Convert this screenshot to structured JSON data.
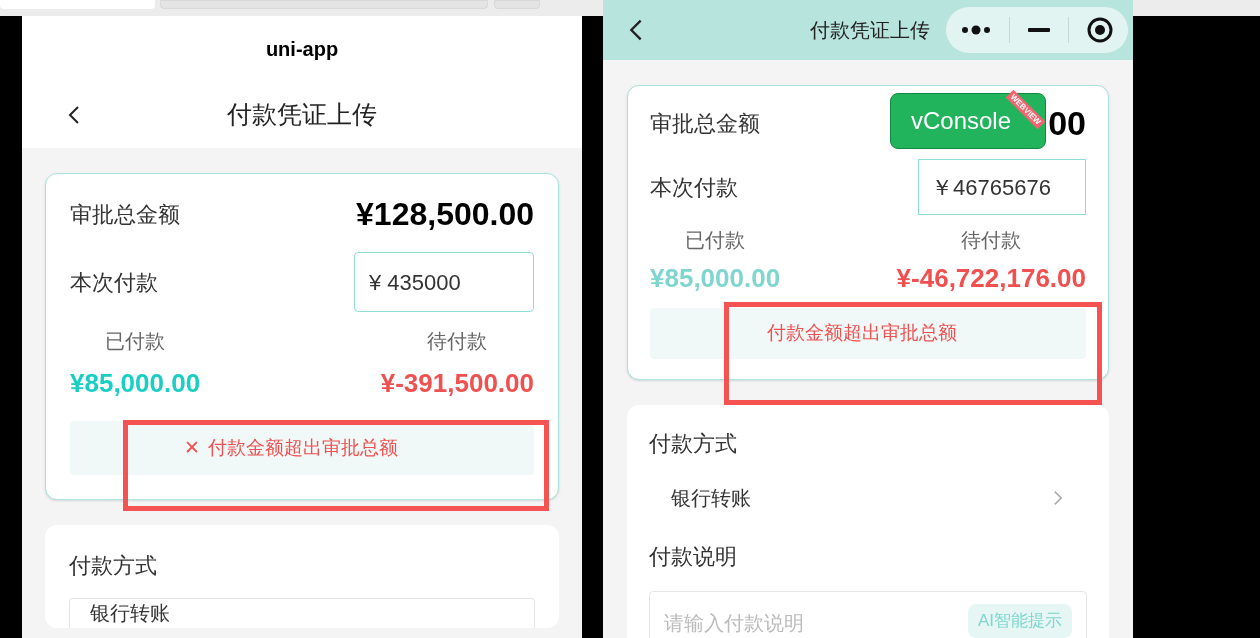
{
  "browser_tabs": [
    {
      "selected": true
    },
    {
      "selected": false
    },
    {
      "selected": false
    }
  ],
  "panels": [
    {
      "kind": "h5",
      "app_name": "uni-app",
      "title": "付款凭证上传",
      "summary": {
        "total_label": "审批总金额",
        "total_value": "¥128,500.00",
        "payment_label": "本次付款",
        "payment_value": "¥ 435000",
        "paid_label": "已付款",
        "paid_value": "¥85,000.00",
        "due_label": "待付款",
        "due_value": "¥-391,500.00",
        "error": {
          "show_icon": true,
          "icon": "✕",
          "text": "付款金额超出审批总额"
        }
      },
      "method": {
        "label": "付款方式",
        "value": "银行转账"
      }
    },
    {
      "kind": "mp",
      "title": "付款凭证上传",
      "summary": {
        "total_label": "审批总金额",
        "total_value": "00",
        "payment_label": "本次付款",
        "payment_value": "￥46765676",
        "paid_label": "已付款",
        "paid_value": "¥85,000.00",
        "due_label": "待付款",
        "due_value": "¥-46,722,176.00",
        "error": {
          "show_icon": false,
          "text": "付款金额超出审批总额"
        }
      },
      "method": {
        "label": "付款方式",
        "value": "银行转账"
      },
      "note": {
        "label": "付款说明",
        "placeholder": "请输入付款说明",
        "ai_button": "AI智能提示"
      },
      "vconsole": {
        "label": "vConsole",
        "ribbon": "WEBVIEW"
      }
    }
  ]
}
